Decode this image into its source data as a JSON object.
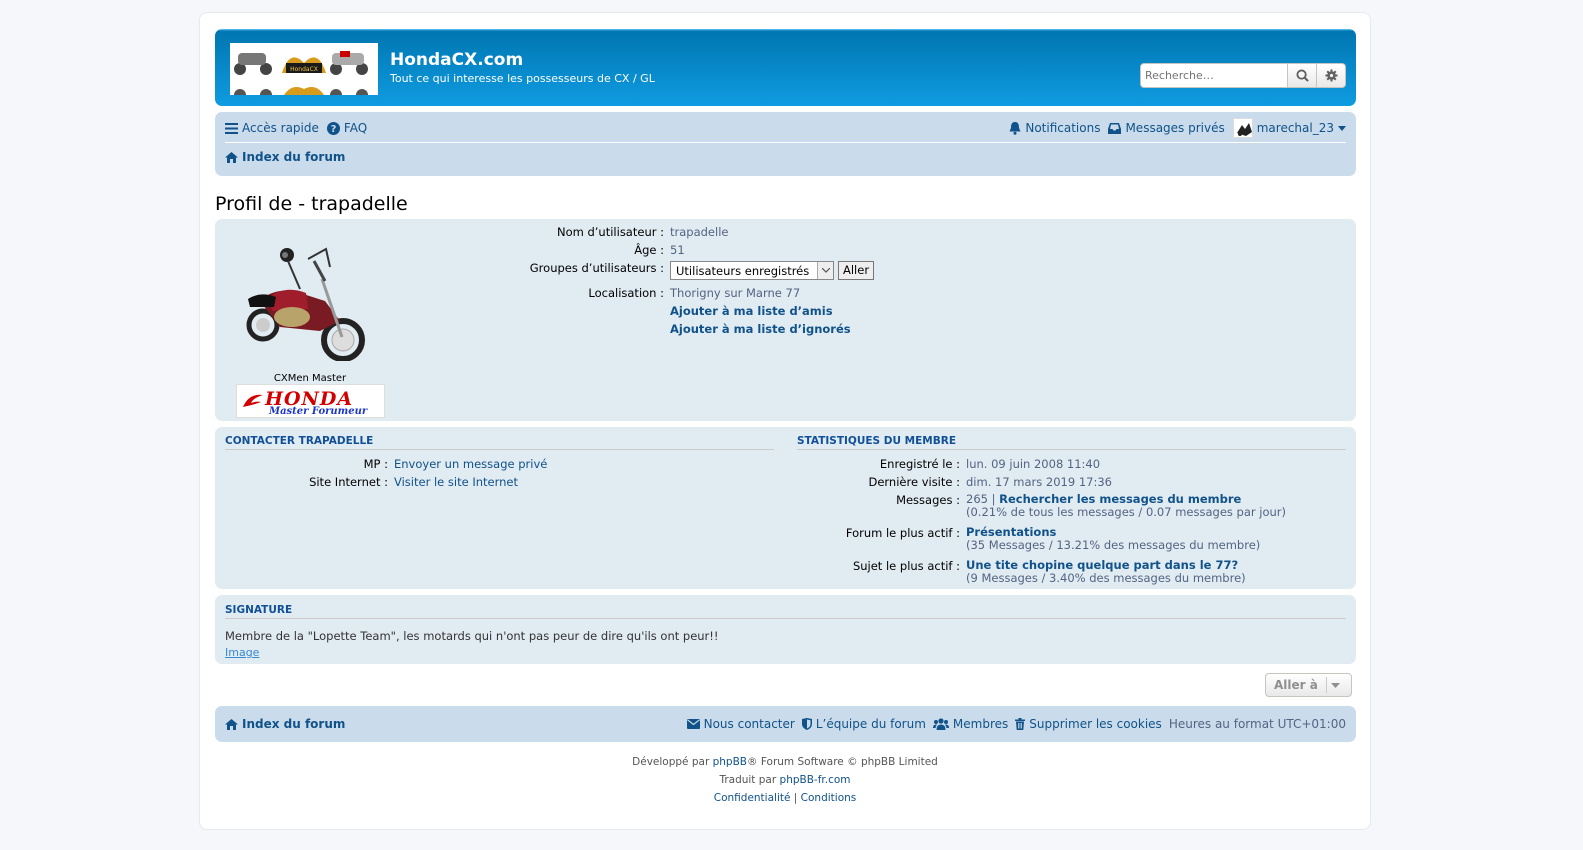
{
  "header": {
    "site_title": "HondaCX.com",
    "site_description": "Tout ce qui interesse les possesseurs de CX / GL",
    "search_placeholder": "Recherche…"
  },
  "navbar": {
    "quick_access": "Accès rapide",
    "faq": "FAQ",
    "notifications": "Notifications",
    "private_messages": "Messages privés",
    "username": "marechal_23",
    "breadcrumb_index": "Index du forum"
  },
  "page_title": "Profil de - trapadelle",
  "profile": {
    "rank_title": "CXMen Master",
    "rank_image_text": "HONDA",
    "rank_image_subtext": "Master Forumeur",
    "username_label": "Nom d’utilisateur :",
    "username_value": "trapadelle",
    "age_label": "Âge :",
    "age_value": "51",
    "groups_label": "Groupes d’utilisateurs :",
    "groups_selected": "Utilisateurs enregistrés",
    "groups_button": "Aller",
    "location_label": "Localisation :",
    "location_value": "Thorigny sur Marne 77",
    "add_friend": "Ajouter à ma liste d’amis",
    "add_foe": "Ajouter à ma liste d’ignorés"
  },
  "contact": {
    "heading": "Contacter trapadelle",
    "pm_label": "MP :",
    "pm_value": "Envoyer un message privé",
    "website_label": "Site Internet :",
    "website_value": "Visiter le site Internet"
  },
  "stats": {
    "heading": "Statistiques du membre",
    "joined_label": "Enregistré le :",
    "joined_value": "lun. 09 juin 2008 11:40",
    "last_visit_label": "Dernière visite :",
    "last_visit_value": "dim. 17 mars 2019 17:36",
    "posts_label": "Messages :",
    "posts_count": "265",
    "posts_separator": "|",
    "posts_search": "Rechercher les messages du membre",
    "posts_detail": "(0.21% de tous les messages / 0.07 messages par jour)",
    "active_forum_label": "Forum le plus actif :",
    "active_forum_value": "Présentations",
    "active_forum_detail": "(35 Messages / 13.21% des messages du membre)",
    "active_topic_label": "Sujet le plus actif :",
    "active_topic_value": "Une tite chopine quelque part dans le 77?",
    "active_topic_detail": "(9 Messages / 3.40% des messages du membre)"
  },
  "signature": {
    "heading": "Signature",
    "text": "Membre de la \"Lopette Team\", les motards qui n'ont pas peur de dire qu'ils ont peur!!",
    "image_link": "Image"
  },
  "jumpbox": {
    "label": "Aller à"
  },
  "footer": {
    "index": "Index du forum",
    "contact": "Nous contacter",
    "team": "L’équipe du forum",
    "members": "Membres",
    "delete_cookies": "Supprimer les cookies",
    "timezone": "Heures au format UTC+01:00",
    "powered_prefix": "Développé par",
    "powered_link": "phpBB",
    "powered_suffix": "® Forum Software © phpBB Limited",
    "translated_prefix": "Traduit par",
    "translated_link": "phpBB-fr.com",
    "privacy": "Confidentialité",
    "sep": "|",
    "terms": "Conditions"
  },
  "colors": {
    "header_blue": "#12a3eb",
    "navbar_bg": "#cadceb",
    "panel_bg": "#e1ebf2",
    "link": "#105289"
  }
}
